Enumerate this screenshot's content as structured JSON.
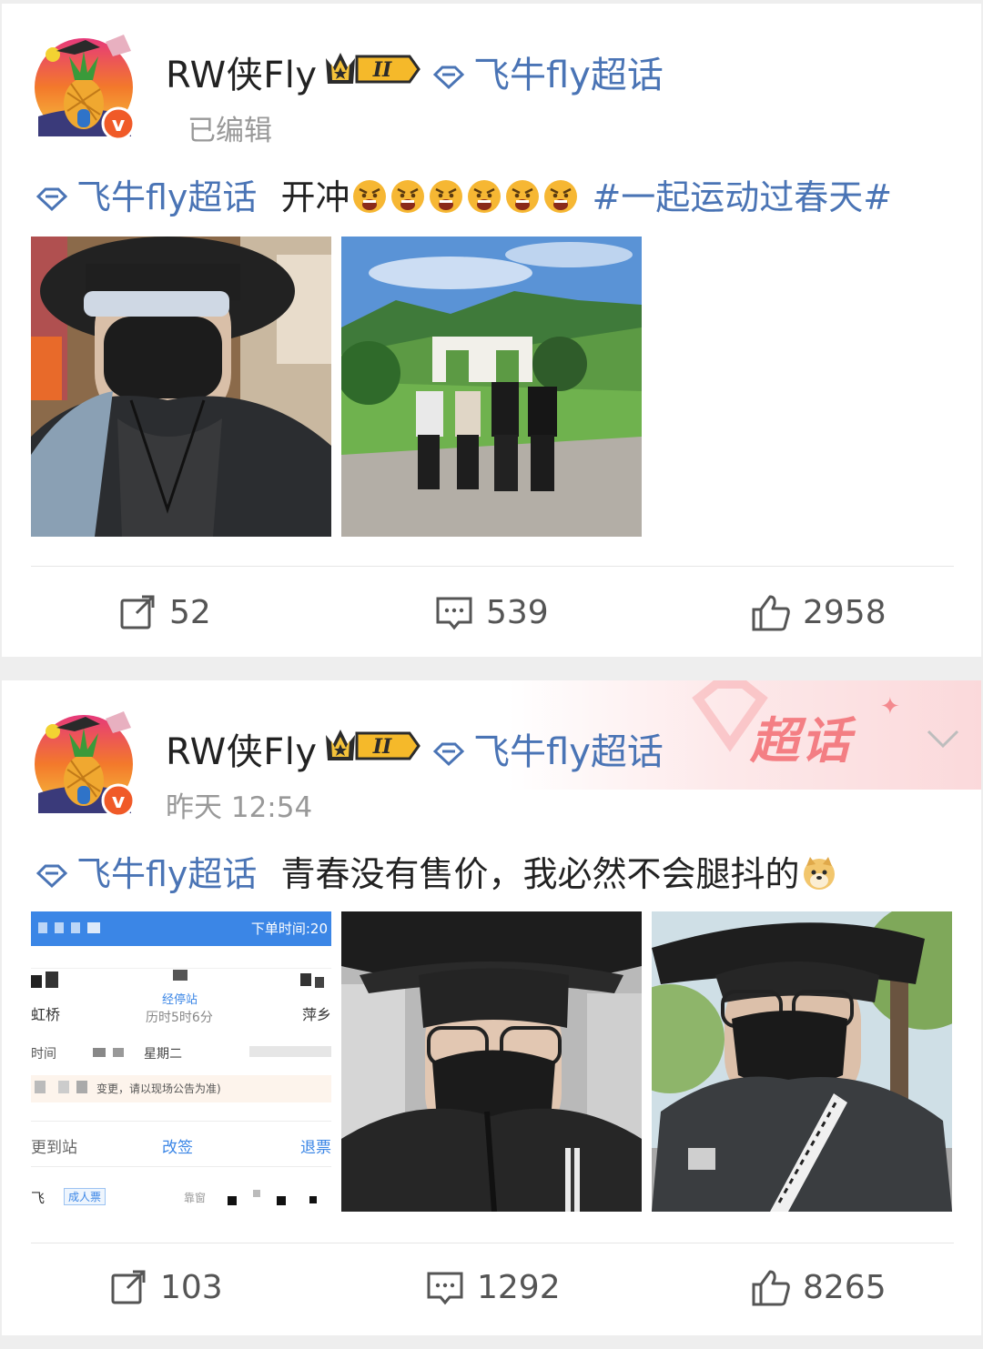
{
  "posts": [
    {
      "author": "RW侠Fly",
      "badge_level": "II",
      "topic": "飞牛fly超话",
      "meta": "已编辑",
      "content_tag": "飞牛fly超话",
      "content_text": "开冲",
      "emojis": [
        "angry-face",
        "angry-face",
        "angry-face",
        "angry-face",
        "angry-face",
        "angry-face"
      ],
      "hashtag": "#一起运动过春天#",
      "photos": [
        "selfie-mirrored-sunglasses",
        "group-photo-mountain-gate"
      ],
      "reposts": "52",
      "comments": "539",
      "likes": "2958"
    },
    {
      "author": "RW侠Fly",
      "badge_level": "II",
      "topic": "飞牛fly超话",
      "meta": "昨天 12:54",
      "content_tag": "飞牛fly超话",
      "content_text": "青春没有售价，我必然不会腿抖的",
      "emojis": [
        "doge-face"
      ],
      "banner": "超话",
      "photos": [
        "train-ticket-screenshot",
        "car-selfie-hat",
        "outdoor-selfie-hat"
      ],
      "ticket": {
        "order_time": "下单时间:20",
        "from": "虹桥",
        "via": "经停站",
        "duration": "历时5时6分",
        "to": "萍乡",
        "time_label": "时间",
        "weekday": "星期二",
        "notice": "变更，请以现场公告为准)",
        "change_station": "更到站",
        "rebook": "改签",
        "refund": "退票",
        "passenger": "飞",
        "ticket_type": "成人票",
        "seat": "靠窗"
      },
      "reposts": "103",
      "comments": "1292",
      "likes": "8265"
    }
  ],
  "colors": {
    "link": "#4a74b5",
    "text": "#222222",
    "meta": "#999999",
    "accent": "#f2666c"
  }
}
